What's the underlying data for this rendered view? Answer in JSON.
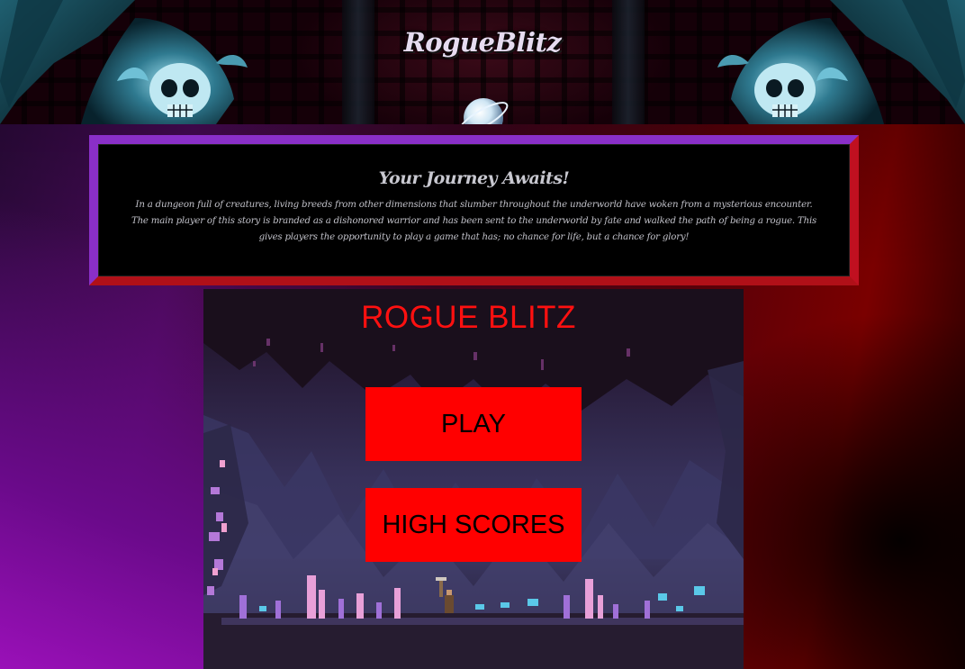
{
  "site": {
    "title": "RogueBlitz"
  },
  "story": {
    "heading": "Your Journey Awaits!",
    "body": "In a dungeon full of creatures, living breeds from other dimensions that slumber throughout the underworld have woken from a mysterious encounter. The main player of this story is branded as a dishonored warrior and has been sent to the underworld by fate and walked the path of being a rogue. This gives players the opportunity to play a game that has; no chance for life, but a chance for glory!"
  },
  "game": {
    "title": "ROGUE BLITZ",
    "play_label": "PLAY",
    "high_scores_label": "HIGH SCORES"
  },
  "colors": {
    "button_red": "#ff0000",
    "game_title_red": "#ff1010",
    "story_border_purple": "#8a2fc8",
    "story_border_red": "#c01020"
  },
  "icons": {
    "banner_left": "gargoyle-skull-icon",
    "banner_right": "gargoyle-skull-icon",
    "banner_center": "planet-orb-icon"
  }
}
